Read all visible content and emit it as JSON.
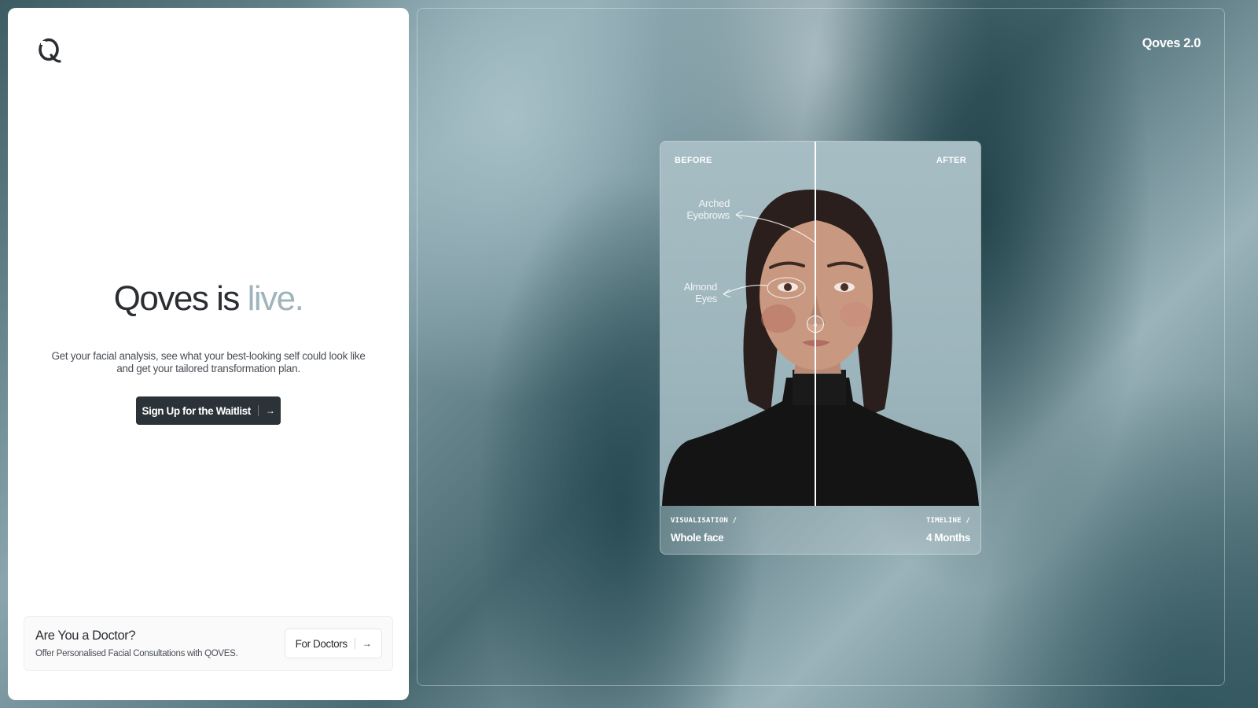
{
  "left_panel": {
    "hero": {
      "title_main": "Qoves is",
      "title_accent": "live.",
      "subtitle": "Get your facial analysis, see what your best-looking self could look like and get your tailored transformation plan."
    },
    "cta_label": "Sign Up for the Waitlist",
    "doctor": {
      "title": "Are You a Doctor?",
      "subtitle": "Offer Personalised Facial Consultations with QOVES.",
      "button_label": "For Doctors"
    }
  },
  "right_panel": {
    "brand": "Qoves 2.0",
    "compare": {
      "before_label": "BEFORE",
      "after_label": "AFTER",
      "annotations": {
        "eyebrows": "Arched Eyebrows",
        "eyes": "Almond Eyes"
      },
      "visualisation_key": "VISUALISATION /",
      "visualisation_value": "Whole face",
      "timeline_key": "TIMELINE /",
      "timeline_value": "4 Months"
    }
  },
  "icons": {
    "logo": "qoves-logo-icon",
    "cta_arrow": "arrow-right-icon",
    "doctor_arrow": "arrow-right-icon",
    "slider_handle": "drag-handle-icon"
  }
}
